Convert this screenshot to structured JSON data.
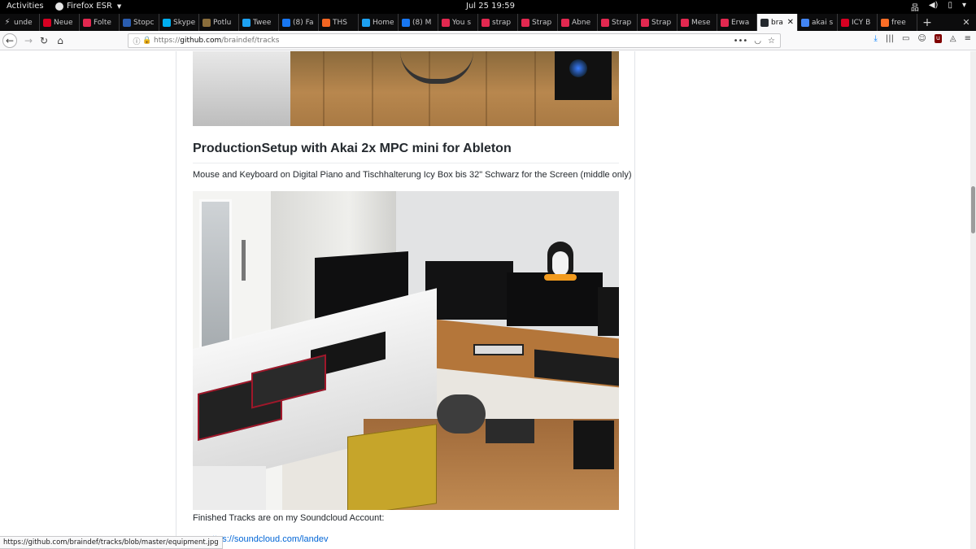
{
  "topbar": {
    "activities": "Activities",
    "app_name": "Firefox ESR",
    "clock": "Jul 25  19:59"
  },
  "tabs": [
    {
      "label": "unde",
      "icon": "bolt-icon",
      "color": "#c7c7c9"
    },
    {
      "label": "Neue",
      "icon": "z-logo-icon",
      "color": "#d70022"
    },
    {
      "label": "Folte",
      "icon": "red-square-icon",
      "color": "#e22850"
    },
    {
      "label": "Stopc",
      "icon": "stack-icon",
      "color": "#2a5db0"
    },
    {
      "label": "Skype",
      "icon": "skype-icon",
      "color": "#00aff0"
    },
    {
      "label": "Potlu",
      "icon": "potluck-icon",
      "color": "#8a6d3b"
    },
    {
      "label": "Twee",
      "icon": "twitter-icon",
      "color": "#1da1f2"
    },
    {
      "label": "(8) Fa",
      "icon": "facebook-icon",
      "color": "#1877f2"
    },
    {
      "label": "THS",
      "icon": "ths-icon",
      "color": "#f26522"
    },
    {
      "label": "Home",
      "icon": "twitter-icon",
      "color": "#1da1f2"
    },
    {
      "label": "(8) M",
      "icon": "facebook-icon",
      "color": "#1877f2"
    },
    {
      "label": "You s",
      "icon": "heart-icon",
      "color": "#e22850"
    },
    {
      "label": "strap",
      "icon": "mail-icon",
      "color": "#e22850"
    },
    {
      "label": "Strap",
      "icon": "mail-icon",
      "color": "#e22850"
    },
    {
      "label": "Abne",
      "icon": "mail-icon",
      "color": "#e22850"
    },
    {
      "label": "Strap",
      "icon": "mail-icon",
      "color": "#e22850"
    },
    {
      "label": "Strap",
      "icon": "mail-icon",
      "color": "#e22850"
    },
    {
      "label": "Mese",
      "icon": "mail-icon",
      "color": "#e22850"
    },
    {
      "label": "Erwa",
      "icon": "mail-icon",
      "color": "#e22850"
    },
    {
      "label": "bra",
      "icon": "github-icon",
      "color": "#24292e",
      "active": true
    },
    {
      "label": "akai s",
      "icon": "google-icon",
      "color": "#4285f4"
    },
    {
      "label": "ICY B",
      "icon": "b-logo-icon",
      "color": "#d70022"
    },
    {
      "label": "free",
      "icon": "gitlab-icon",
      "color": "#fc6d26"
    }
  ],
  "navbar": {
    "url_prefix": "https://",
    "url_host": "github.com",
    "url_path": "/braindef/tracks"
  },
  "article": {
    "heading": "ProductionSetup with Akai 2x MPC mini for Ableton",
    "para1": "Mouse and Keyboard on Digital Piano and Tischhalterung Icy Box bis 32\" Schwarz for the Screen (middle only)",
    "para2": "Finished Tracks are on my Soundcloud Account:",
    "link1": "ttps://soundcloud.com/landev"
  },
  "status": {
    "hover_url": "https://github.com/braindef/tracks/blob/master/equipment.jpg"
  }
}
